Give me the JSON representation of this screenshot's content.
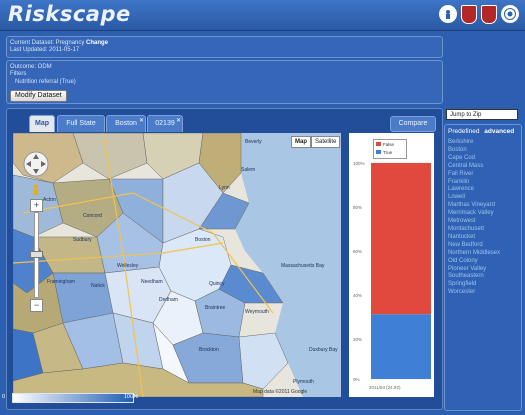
{
  "app": {
    "title": "Riskscape"
  },
  "logos": [
    "children-hospital-logo",
    "harvard-shield-logo",
    "mit-shield-logo",
    "seal-logo"
  ],
  "dataset": {
    "current_label": "Current Dataset: Pregnancy",
    "change_link": "Change",
    "last_updated": "Last Updated: 2011-05-17",
    "outcome": "Outcome: ODM",
    "filters_label": "Filters",
    "filter_value": "Nutrition referral (True)",
    "modify_button": "Modify Dataset"
  },
  "tabs": [
    {
      "label": "Map",
      "active": true,
      "closable": false
    },
    {
      "label": "Full State",
      "active": false,
      "closable": false
    },
    {
      "label": "Boston",
      "active": false,
      "closable": true
    },
    {
      "label": "02139",
      "active": false,
      "closable": true
    }
  ],
  "compare_button": "Compare",
  "map": {
    "map_button": "Map",
    "satellite_button": "Satellite",
    "attribution": "Map data ©2011 Google",
    "place_labels": [
      "Beverly",
      "Salem",
      "Lynn",
      "Boston",
      "Quincy",
      "Braintree",
      "Framingham",
      "Natick",
      "Wellesley",
      "Needham",
      "Dedham",
      "Weymouth",
      "Plymouth",
      "Massachusetts Bay",
      "Duxbury Bay",
      "Brockton",
      "Sudbury",
      "Concord",
      "Acton"
    ]
  },
  "chart_data": {
    "type": "bar",
    "categories": [
      "2011/03 (24.92)"
    ],
    "series": [
      {
        "name": "False",
        "values": [
          70
        ],
        "color": "#e04a3c"
      },
      {
        "name": "True",
        "values": [
          30
        ],
        "color": "#3f7fd6"
      }
    ],
    "ylim": [
      0,
      100
    ],
    "yticks": [
      "100%",
      "80%",
      "60%",
      "40%",
      "20%",
      "0%"
    ],
    "stacked": true
  },
  "jump": {
    "placeholder": "Jump to Zip"
  },
  "regions": {
    "tab_predefined": "Predefined",
    "tab_advanced": "advanced",
    "items": [
      "Berkshire",
      "Boston",
      "Cape Cod",
      "Central Mass",
      "Fall River",
      "Franklin",
      "Lawrence",
      "Lowell",
      "Marthas Vineyard",
      "Merrimack Valley",
      "Metrowest",
      "Montachusett",
      "Nantucket",
      "New Bedford",
      "Northern Middlesex",
      "Old Colony",
      "Pioneer Valley",
      "Southeastern",
      "Springfield",
      "Worcester"
    ]
  },
  "color_legend": {
    "min_label": "0",
    "max_label": "100%",
    "low_color": "#ffffff",
    "high_color": "#1f5db5"
  },
  "colors": {
    "bg": "#2d5fb0",
    "panel": "#3566b8",
    "false_red": "#e04a3c",
    "true_blue": "#3f7fd6"
  }
}
